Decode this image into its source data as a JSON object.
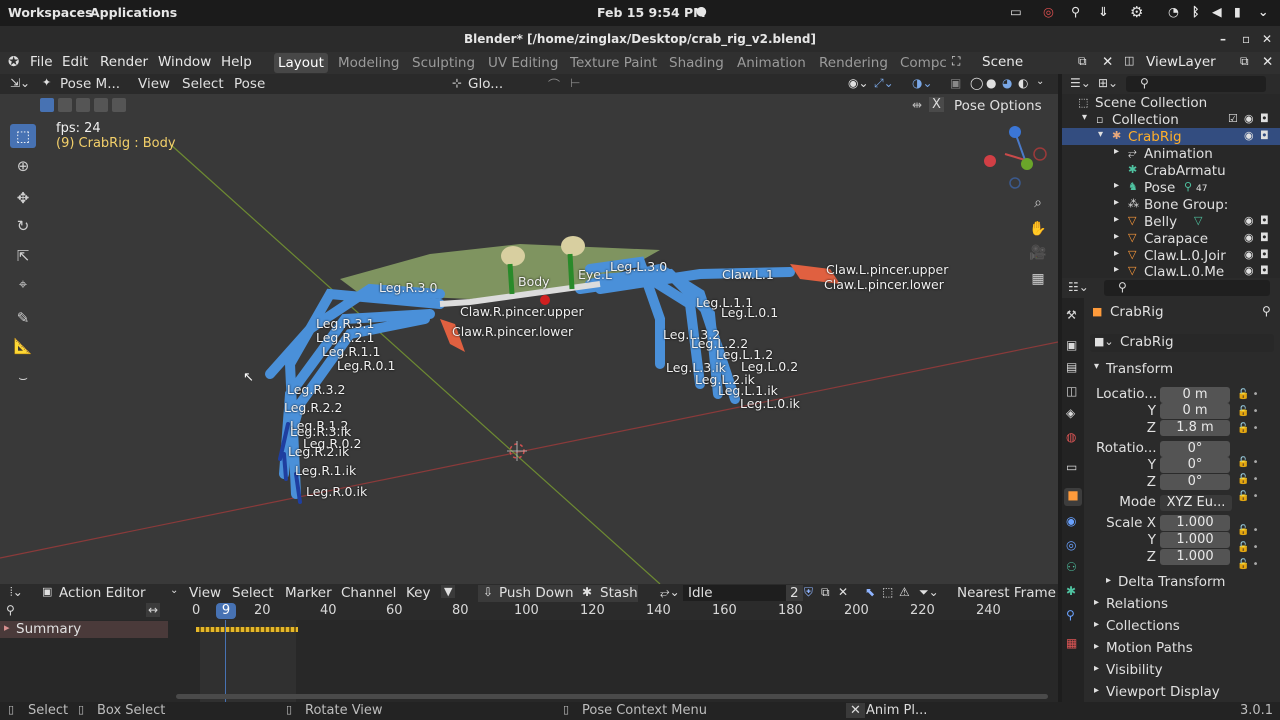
{
  "system_bar": {
    "workspaces": "Workspaces",
    "applications": "Applications",
    "datetime": "Feb 15  9:54 PM"
  },
  "window_title": "Blender* [/home/zinglax/Desktop/crab_rig_v2.blend]",
  "menu": {
    "items": [
      "File",
      "Edit",
      "Render",
      "Window",
      "Help"
    ],
    "workspaces": [
      "Layout",
      "Modeling",
      "Sculpting",
      "UV Editing",
      "Texture Paint",
      "Shading",
      "Animation",
      "Rendering",
      "Compc"
    ],
    "scene": "Scene",
    "view_layer": "ViewLayer"
  },
  "viewport_header": {
    "mode": "Pose M...",
    "view": "View",
    "select": "Select",
    "pose": "Pose",
    "orientation": "Glo...",
    "pose_options": "Pose Options"
  },
  "viewport": {
    "fps": "fps: 24",
    "active": "(9) CrabRig : Body"
  },
  "bones": [
    {
      "name": "Leg.R.3.0"
    },
    {
      "name": "Leg.R.3.1"
    },
    {
      "name": "Leg.R.2.1"
    },
    {
      "name": "Leg.R.1.1"
    },
    {
      "name": "Leg.R.0.1"
    },
    {
      "name": "Leg.R.3.2"
    },
    {
      "name": "Leg.R.2.2"
    },
    {
      "name": "Leg.R.1.2"
    },
    {
      "name": "Leg.R.3.ik"
    },
    {
      "name": "Leg.R.0.2"
    },
    {
      "name": "Leg.R.2.ik"
    },
    {
      "name": "Leg.R.1.ik"
    },
    {
      "name": "Leg.R.0.ik"
    },
    {
      "name": "Body"
    },
    {
      "name": "Eye.L"
    },
    {
      "name": "Claw.R.pincer.upper"
    },
    {
      "name": "Claw.R.pincer.lower"
    },
    {
      "name": "Leg.L.3.0"
    },
    {
      "name": "Claw.L.1"
    },
    {
      "name": "Claw.L.pincer.upper"
    },
    {
      "name": "Claw.L.pincer.lower"
    },
    {
      "name": "Leg.L.1.1"
    },
    {
      "name": "Leg.L.0.1"
    },
    {
      "name": "Leg.L.3.2"
    },
    {
      "name": "Leg.L.2.2"
    },
    {
      "name": "Leg.L.1.2"
    },
    {
      "name": "Leg.L.0.2"
    },
    {
      "name": "Leg.L.3.ik"
    },
    {
      "name": "Leg.L.2.ik"
    },
    {
      "name": "Leg.L.1.ik"
    },
    {
      "name": "Leg.L.0.ik"
    }
  ],
  "action_editor": {
    "mode": "Action Editor",
    "view": "View",
    "select": "Select",
    "marker": "Marker",
    "channel": "Channel",
    "key": "Key",
    "push_down": "Push Down",
    "stash": "Stash",
    "action": "Idle",
    "users": "2",
    "snap": "Nearest Frame",
    "summary": "Summary",
    "current_frame": "9",
    "ticks": [
      "0",
      "20",
      "40",
      "60",
      "80",
      "100",
      "120",
      "140",
      "160",
      "180",
      "200",
      "220",
      "240"
    ]
  },
  "statusbar": {
    "select": "Select",
    "box_select": "Box Select",
    "rotate": "Rotate View",
    "context": "Pose Context Menu",
    "anim": "Anim Pl...",
    "version": "3.0.1"
  },
  "outliner": {
    "rows": [
      "Scene Collection",
      "Collection",
      "CrabRig",
      "Animation",
      "CrabArmatu",
      "Pose",
      "Bone Group:",
      "Belly",
      "Carapace",
      "Claw.L.0.Joir",
      "Claw.L.0.Me"
    ],
    "pose_count": "47"
  },
  "properties": {
    "object_name": "CrabRig",
    "data_name": "CrabRig",
    "transform": "Transform",
    "location_label": "Locatio...",
    "loc": [
      "0 m",
      "0 m",
      "1.8 m"
    ],
    "rotation_label": "Rotatio...",
    "rot": [
      "0°",
      "0°",
      "0°"
    ],
    "mode_label": "Mode",
    "mode": "XYZ Eu...",
    "scale_label": "Scale X",
    "scale": [
      "1.000",
      "1.000",
      "1.000"
    ],
    "y": "Y",
    "z": "Z",
    "sections": [
      "Delta Transform",
      "Relations",
      "Collections",
      "Motion Paths",
      "Visibility",
      "Viewport Display"
    ]
  }
}
